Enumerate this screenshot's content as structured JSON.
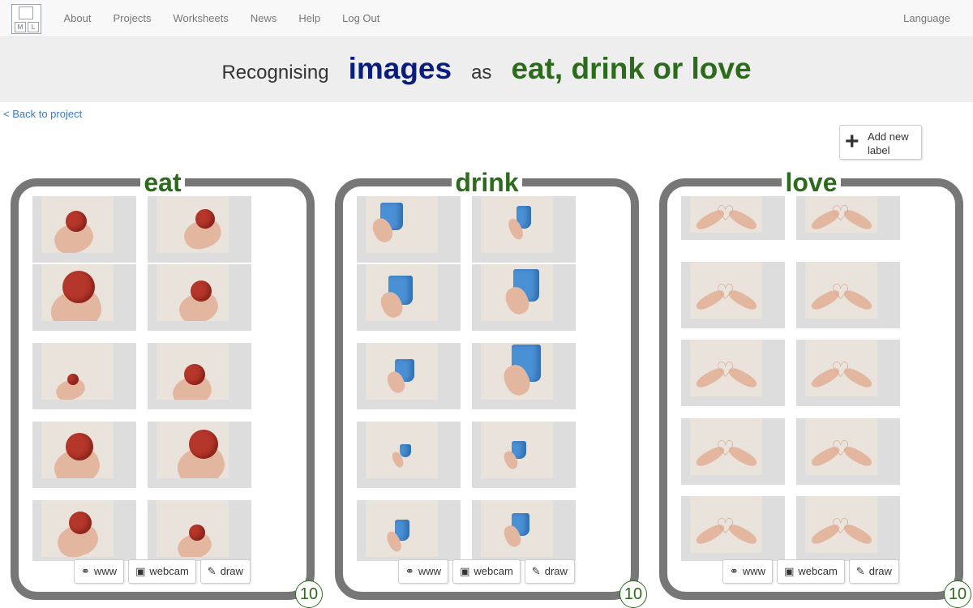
{
  "nav": {
    "logo_letters": [
      "M",
      "L"
    ],
    "links": [
      "About",
      "Projects",
      "Worksheets",
      "News",
      "Help",
      "Log Out"
    ],
    "language": "Language"
  },
  "banner": {
    "prefix": "Recognising",
    "data_type": "images",
    "connector": "as",
    "labels_text": "eat, drink or love"
  },
  "back_link": "< Back to project",
  "add_label": {
    "icon": "plus-icon",
    "text": "Add new label"
  },
  "colors": {
    "label_green": "#2c6b1b",
    "images_blue": "#0b1d7a",
    "bucket_grey": "#777777",
    "link_blue": "#3a7bbf"
  },
  "buttons": {
    "www": {
      "icon": "link-icon",
      "label": "www"
    },
    "webcam": {
      "icon": "camera-icon",
      "label": "webcam"
    },
    "draw": {
      "icon": "pencil-icon",
      "label": "draw"
    }
  },
  "buckets": [
    {
      "label": "eat",
      "count": "10",
      "thumb_kind": "apple"
    },
    {
      "label": "drink",
      "count": "10",
      "thumb_kind": "cup"
    },
    {
      "label": "love",
      "count": "10",
      "thumb_kind": "heart-hands"
    }
  ]
}
